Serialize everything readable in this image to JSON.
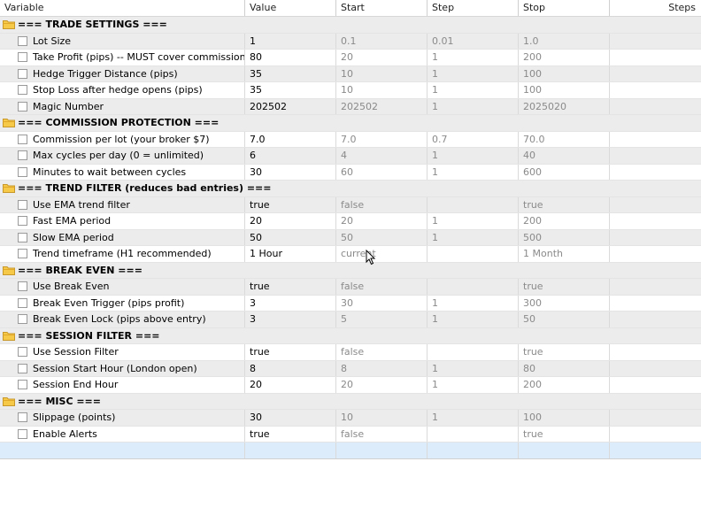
{
  "columns": {
    "variable": "Variable",
    "value": "Value",
    "start": "Start",
    "step": "Step",
    "stop": "Stop",
    "steps": "Steps"
  },
  "icons": {
    "group": "folder-icon",
    "param": "checkbox-icon",
    "pointer": "mouse-cursor-icon"
  },
  "colors": {
    "folder": "#f7c948",
    "alt_row": "#ececec",
    "selected_row": "#dcecfb"
  },
  "rows": [
    {
      "type": "group",
      "label": "=== TRADE SETTINGS ==="
    },
    {
      "type": "var",
      "name": "Lot Size",
      "value": "1",
      "start": "0.1",
      "step": "0.01",
      "stop": "1.0"
    },
    {
      "type": "var",
      "name": "Take Profit (pips) -- MUST cover commission r...",
      "value": "80",
      "start": "20",
      "step": "1",
      "stop": "200"
    },
    {
      "type": "var",
      "name": "Hedge Trigger Distance (pips)",
      "value": "35",
      "start": "10",
      "step": "1",
      "stop": "100"
    },
    {
      "type": "var",
      "name": "Stop Loss after hedge opens (pips)",
      "value": "35",
      "start": "10",
      "step": "1",
      "stop": "100"
    },
    {
      "type": "var",
      "name": "Magic Number",
      "value": "202502",
      "start": "202502",
      "step": "1",
      "stop": "2025020"
    },
    {
      "type": "group",
      "label": "=== COMMISSION PROTECTION ==="
    },
    {
      "type": "var",
      "name": "Commission per lot (your broker $7)",
      "value": "7.0",
      "start": "7.0",
      "step": "0.7",
      "stop": "70.0"
    },
    {
      "type": "var",
      "name": "Max cycles per day (0 = unlimited)",
      "value": "6",
      "start": "4",
      "step": "1",
      "stop": "40"
    },
    {
      "type": "var",
      "name": "Minutes to wait between cycles",
      "value": "30",
      "start": "60",
      "step": "1",
      "stop": "600"
    },
    {
      "type": "group",
      "label": "=== TREND FILTER (reduces bad entries) ==="
    },
    {
      "type": "var",
      "name": "Use EMA trend filter",
      "value": "true",
      "start": "false",
      "step": "",
      "stop": "true"
    },
    {
      "type": "var",
      "name": "Fast EMA period",
      "value": "20",
      "start": "20",
      "step": "1",
      "stop": "200"
    },
    {
      "type": "var",
      "name": "Slow EMA period",
      "value": "50",
      "start": "50",
      "step": "1",
      "stop": "500"
    },
    {
      "type": "var",
      "name": "Trend timeframe (H1 recommended)",
      "value": "1 Hour",
      "start": "current",
      "step": "",
      "stop": "1 Month"
    },
    {
      "type": "group",
      "label": "=== BREAK EVEN ==="
    },
    {
      "type": "var",
      "name": "Use Break Even",
      "value": "true",
      "start": "false",
      "step": "",
      "stop": "true"
    },
    {
      "type": "var",
      "name": "Break Even Trigger (pips profit)",
      "value": "3",
      "start": "30",
      "step": "1",
      "stop": "300"
    },
    {
      "type": "var",
      "name": "Break Even Lock (pips above entry)",
      "value": "3",
      "start": "5",
      "step": "1",
      "stop": "50"
    },
    {
      "type": "group",
      "label": "=== SESSION FILTER ==="
    },
    {
      "type": "var",
      "name": "Use Session Filter",
      "value": "true",
      "start": "false",
      "step": "",
      "stop": "true"
    },
    {
      "type": "var",
      "name": "Session Start Hour (London open)",
      "value": "8",
      "start": "8",
      "step": "1",
      "stop": "80"
    },
    {
      "type": "var",
      "name": "Session End Hour",
      "value": "20",
      "start": "20",
      "step": "1",
      "stop": "200"
    },
    {
      "type": "group",
      "label": "=== MISC ==="
    },
    {
      "type": "var",
      "name": "Slippage (points)",
      "value": "30",
      "start": "10",
      "step": "1",
      "stop": "100"
    },
    {
      "type": "var",
      "name": "Enable Alerts",
      "value": "true",
      "start": "false",
      "step": "",
      "stop": "true"
    }
  ]
}
